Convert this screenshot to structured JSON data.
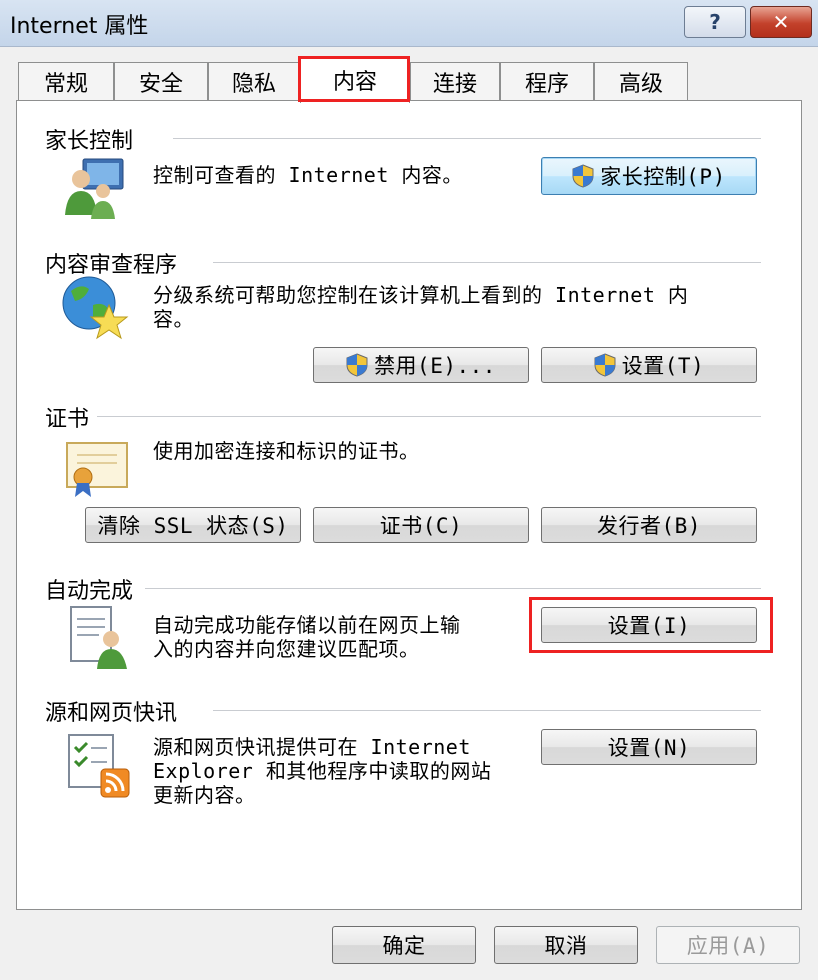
{
  "window": {
    "title": "Internet 属性",
    "help_label": "?",
    "close_label": "✕"
  },
  "tabs": [
    {
      "label": "常规"
    },
    {
      "label": "安全"
    },
    {
      "label": "隐私"
    },
    {
      "label": "内容",
      "active": true
    },
    {
      "label": "连接"
    },
    {
      "label": "程序"
    },
    {
      "label": "高级"
    }
  ],
  "sections": {
    "parental": {
      "title": "家长控制",
      "description": "控制可查看的 Internet 内容。",
      "button": "家长控制(P)"
    },
    "advisor": {
      "title": "内容审查程序",
      "description_line1": "分级系统可帮助您控制在该计算机上看到的 Internet 内",
      "description_line2": "容。",
      "disable_button": "禁用(E)...",
      "settings_button": "设置(T)"
    },
    "certificates": {
      "title": "证书",
      "description": "使用加密连接和标识的证书。",
      "clear_ssl_button": "清除 SSL 状态(S)",
      "certificates_button": "证书(C)",
      "publishers_button": "发行者(B)"
    },
    "autocomplete": {
      "title": "自动完成",
      "description_line1": "自动完成功能存储以前在网页上输",
      "description_line2": "入的内容并向您建议匹配项。",
      "settings_button": "设置(I)"
    },
    "feeds": {
      "title": "源和网页快讯",
      "description_line1": "源和网页快讯提供可在 Internet",
      "description_line2": "Explorer 和其他程序中读取的网站",
      "description_line3": "更新内容。",
      "settings_button": "设置(N)"
    }
  },
  "footer": {
    "ok": "确定",
    "cancel": "取消",
    "apply": "应用(A)"
  },
  "colors": {
    "highlight_red": "#e22222",
    "default_button_border": "#3c7fb1",
    "title_bar": "#c4d5ea"
  }
}
